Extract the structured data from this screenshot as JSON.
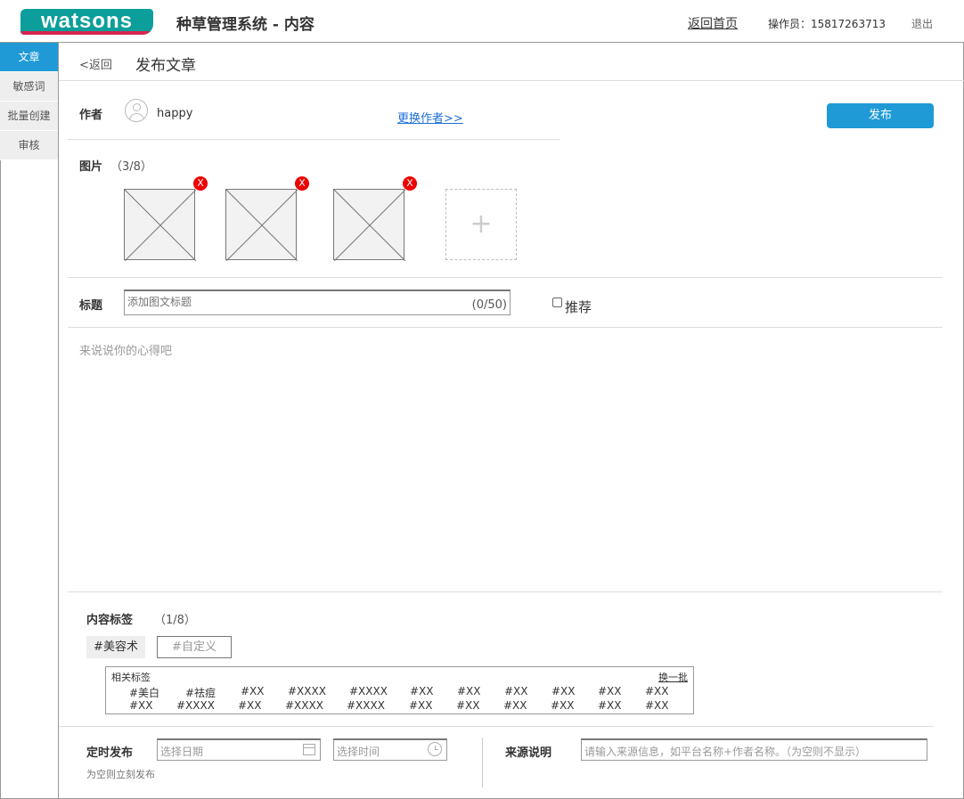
{
  "header": {
    "logo_text": "watsons",
    "app_title": "种草管理系统 - 内容",
    "home_link": "返回首页",
    "operator": "操作员：15817263713",
    "logout": "退出"
  },
  "sidebar": {
    "items": [
      {
        "label": "文章",
        "active": true
      },
      {
        "label": "敏感词",
        "active": false
      },
      {
        "label": "批量创建",
        "active": false
      },
      {
        "label": "审核",
        "active": false
      }
    ]
  },
  "page": {
    "back": "<返回",
    "title": "发布文章"
  },
  "author": {
    "label": "作者",
    "name": "happy",
    "change_link": "更换作者>>",
    "avatar_icon": "user-avatar-icon"
  },
  "publish_button": "发布",
  "images": {
    "label": "图片",
    "count": "（3/8）",
    "remove_label": "X",
    "add_label": "+",
    "slots": 3
  },
  "title_field": {
    "label": "标题",
    "placeholder": "添加图文标题",
    "counter": "(0/50)",
    "recommend_label": "推荐"
  },
  "content": {
    "placeholder": "来说说你的心得吧"
  },
  "tags": {
    "label": "内容标签",
    "count": "（1/8）",
    "selected": "#美容术",
    "custom_placeholder": "#自定义",
    "related_title": "相关标签",
    "refresh": "换一批",
    "row1": [
      "#美白",
      "#祛痘",
      "#XX",
      "#XXXX",
      "#XXXX",
      "#XX",
      "#XX",
      "#XX",
      "#XX",
      "#XX",
      "#XX"
    ],
    "row2": [
      "#XX",
      "#XXXX",
      "#XX",
      "#XXXX",
      "#XXXX",
      "#XX",
      "#XX",
      "#XX",
      "#XX",
      "#XX",
      "#XX"
    ]
  },
  "schedule": {
    "label": "定时发布",
    "date_placeholder": "选择日期",
    "time_placeholder": "选择时间",
    "note": "为空则立刻发布"
  },
  "source": {
    "label": "来源说明",
    "placeholder": "请输入来源信息，如平台名称+作者名称。（为空则不显示）"
  },
  "colors": {
    "accent": "#1f9ad6",
    "brand": "#0b9e9a",
    "remove": "#e00000"
  }
}
